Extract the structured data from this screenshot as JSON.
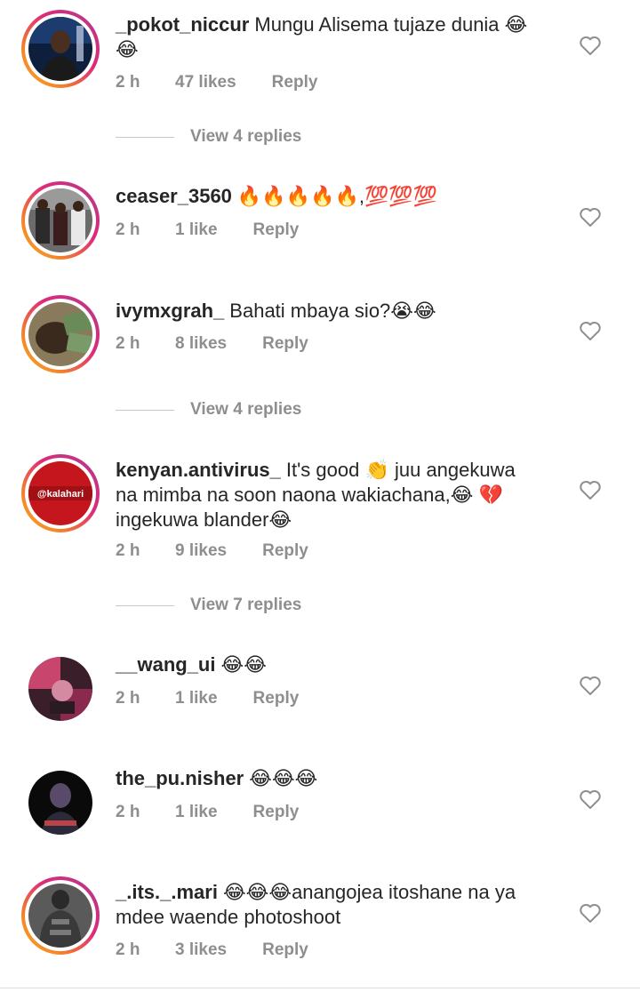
{
  "comments": [
    {
      "username": "_pokot_niccur",
      "text": "Mungu Alisema tujaze dunia 😂😂",
      "time": "2 h",
      "likes": "47 likes",
      "reply": "Reply",
      "replies": "View 4 replies"
    },
    {
      "username": "ceaser_3560",
      "text": "🔥🔥🔥🔥🔥,💯💯💯",
      "time": "2 h",
      "likes": "1 like",
      "reply": "Reply"
    },
    {
      "username": "ivymxgrah_",
      "text": "Bahati mbaya sio?😭😂",
      "time": "2 h",
      "likes": "8 likes",
      "reply": "Reply",
      "replies": "View 4 replies"
    },
    {
      "username": "kenyan.antivirus_",
      "text": "It's good 👏 juu angekuwa na mimba na soon naona wakiachana,😂 💔 ingekuwa blander😂",
      "avatar_text": "@kalahari",
      "time": "2 h",
      "likes": "9 likes",
      "reply": "Reply",
      "replies": "View 7 replies"
    },
    {
      "username": "__wang_ui",
      "text": "😂😂",
      "time": "2 h",
      "likes": "1 like",
      "reply": "Reply"
    },
    {
      "username": "the_pu.nisher",
      "text": "😂😂😂",
      "time": "2 h",
      "likes": "1 like",
      "reply": "Reply"
    },
    {
      "username": "_.its._.mari",
      "text": "😂😂😂anangojea itoshane na ya mdee waende photoshoot",
      "time": "2 h",
      "likes": "3 likes",
      "reply": "Reply"
    }
  ],
  "icons": {
    "like": "heart-outline-icon"
  },
  "colors": {
    "text": "#262626",
    "muted": "#8e8e8e",
    "ring_start": "#f9a825",
    "ring_end": "#8134af"
  }
}
